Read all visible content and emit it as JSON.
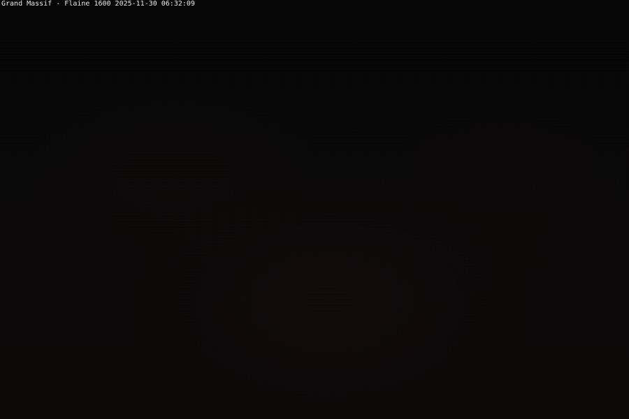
{
  "overlay": {
    "location": "Grand Massif - Flaine 1600",
    "date": "2025-11-30",
    "time": "06:32:09"
  }
}
